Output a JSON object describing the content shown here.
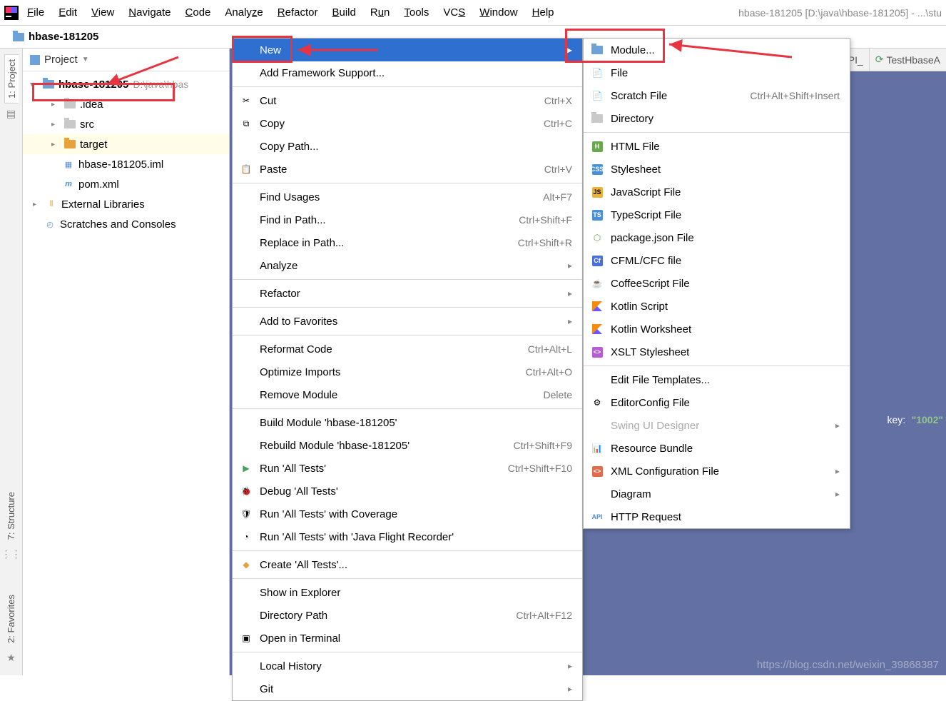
{
  "menubar": {
    "items": [
      {
        "pre": "",
        "u": "F",
        "post": "ile"
      },
      {
        "pre": "",
        "u": "E",
        "post": "dit"
      },
      {
        "pre": "",
        "u": "V",
        "post": "iew"
      },
      {
        "pre": "",
        "u": "N",
        "post": "avigate"
      },
      {
        "pre": "",
        "u": "C",
        "post": "ode"
      },
      {
        "pre": "Analy",
        "u": "z",
        "post": "e"
      },
      {
        "pre": "",
        "u": "R",
        "post": "efactor"
      },
      {
        "pre": "",
        "u": "B",
        "post": "uild"
      },
      {
        "pre": "R",
        "u": "u",
        "post": "n"
      },
      {
        "pre": "",
        "u": "T",
        "post": "ools"
      },
      {
        "pre": "VC",
        "u": "S",
        "post": ""
      },
      {
        "pre": "",
        "u": "W",
        "post": "indow"
      },
      {
        "pre": "",
        "u": "H",
        "post": "elp"
      }
    ],
    "title": "hbase-181205 [D:\\java\\hbase-181205] - ...\\stu"
  },
  "crumb": {
    "name": "hbase-181205"
  },
  "panel": {
    "label": "Project",
    "root": "hbase-181205",
    "root_path": "D:\\java\\hbas",
    "items": [
      {
        "name": ".idea",
        "type": "folder"
      },
      {
        "name": "src",
        "type": "folder"
      },
      {
        "name": "target",
        "type": "folder-orange",
        "hl": true
      },
      {
        "name": "hbase-181205.iml",
        "type": "iml"
      },
      {
        "name": "pom.xml",
        "type": "pom"
      }
    ],
    "external": "External Libraries",
    "scratches": "Scratches and Consoles"
  },
  "side_tabs": {
    "project": "1: Project",
    "structure": "7: Structure",
    "favorites": "2: Favorites"
  },
  "editor_tabs": {
    "tab1": "stHbaseAPI_",
    "tab2": "TestHbaseA"
  },
  "code": {
    "key_label": "key:",
    "key_val": "\"1002\""
  },
  "ctx": {
    "new": "New",
    "addfw": "Add Framework Support...",
    "cut": "Cut",
    "cut_sc": "Ctrl+X",
    "copy": "Copy",
    "copy_sc": "Ctrl+C",
    "copypath": "Copy Path...",
    "paste": "Paste",
    "paste_sc": "Ctrl+V",
    "findusages": "Find Usages",
    "findusages_sc": "Alt+F7",
    "findinpath": "Find in Path...",
    "findinpath_sc": "Ctrl+Shift+F",
    "replaceinpath": "Replace in Path...",
    "replaceinpath_sc": "Ctrl+Shift+R",
    "analyze": "Analyze",
    "refactor": "Refactor",
    "addfav": "Add to Favorites",
    "reformat": "Reformat Code",
    "reformat_sc": "Ctrl+Alt+L",
    "optimize": "Optimize Imports",
    "optimize_sc": "Ctrl+Alt+O",
    "remove": "Remove Module",
    "remove_sc": "Delete",
    "buildmod": "Build Module 'hbase-181205'",
    "rebuildmod": "Rebuild Module 'hbase-181205'",
    "rebuildmod_sc": "Ctrl+Shift+F9",
    "run": "Run 'All Tests'",
    "run_sc": "Ctrl+Shift+F10",
    "debug": "Debug 'All Tests'",
    "coverage": "Run 'All Tests' with Coverage",
    "jfr": "Run 'All Tests' with 'Java Flight Recorder'",
    "create": "Create 'All Tests'...",
    "explorer": "Show in Explorer",
    "dirpath": "Directory Path",
    "dirpath_sc": "Ctrl+Alt+F12",
    "terminal": "Open in Terminal",
    "history": "Local History",
    "git": "Git"
  },
  "sub": {
    "module": "Module...",
    "file": "File",
    "scratch": "Scratch File",
    "scratch_sc": "Ctrl+Alt+Shift+Insert",
    "directory": "Directory",
    "html": "HTML File",
    "css": "Stylesheet",
    "js": "JavaScript File",
    "ts": "TypeScript File",
    "pkg": "package.json File",
    "cfml": "CFML/CFC file",
    "coffee": "CoffeeScript File",
    "kts": "Kotlin Script",
    "ktw": "Kotlin Worksheet",
    "xslt": "XSLT Stylesheet",
    "editft": "Edit File Templates...",
    "editorconfig": "EditorConfig File",
    "swing": "Swing UI Designer",
    "resbundle": "Resource Bundle",
    "xmlconf": "XML Configuration File",
    "diagram": "Diagram",
    "http": "HTTP Request"
  },
  "watermark": "https://blog.csdn.net/weixin_39868387"
}
